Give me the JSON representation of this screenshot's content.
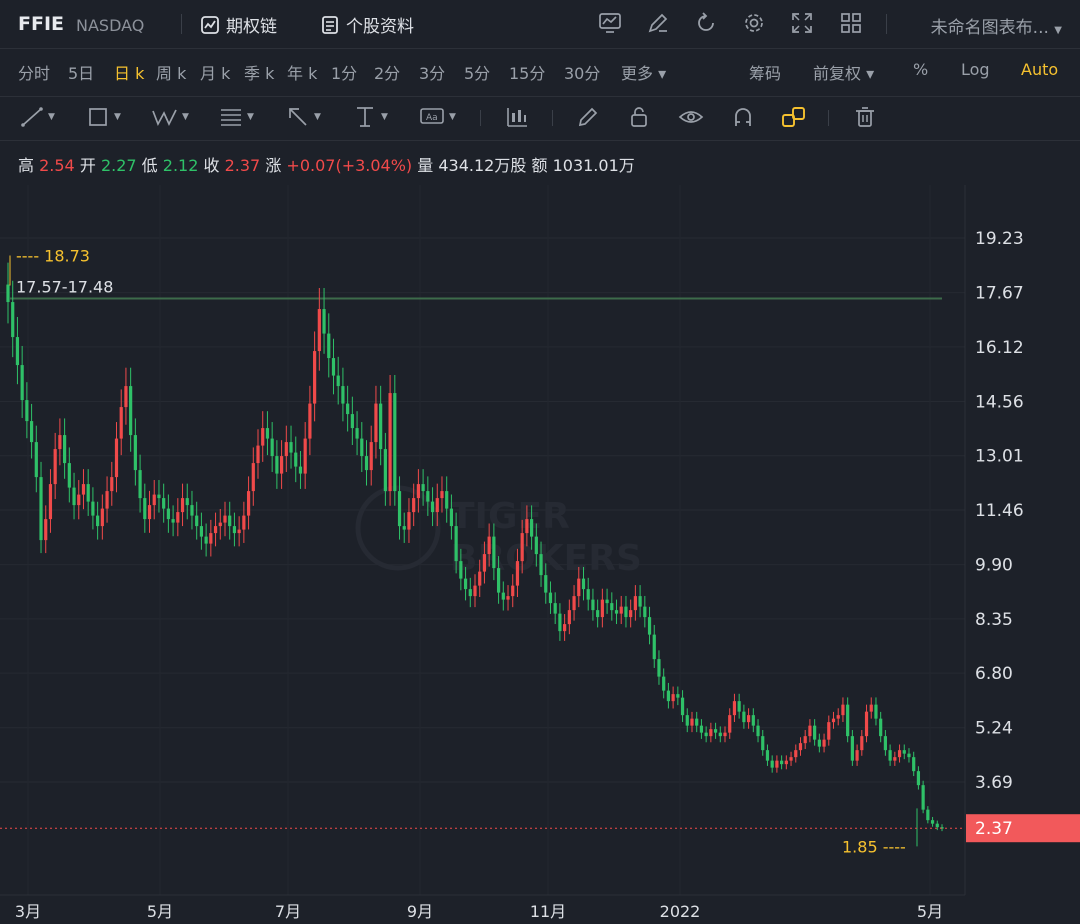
{
  "header": {
    "ticker": "FFIE",
    "exchange": "NASDAQ",
    "options_chain_label": "期权链",
    "profile_label": "个股资料",
    "layout_name": "未命名图表布..."
  },
  "periods": {
    "items": [
      "分时",
      "5日",
      "日 k",
      "周 k",
      "月 k",
      "季 k",
      "年 k",
      "1分",
      "2分",
      "3分",
      "5分",
      "15分",
      "30分",
      "更多"
    ],
    "active": "日 k",
    "right_options": [
      "筹码",
      "前复权",
      "%",
      "Log",
      "Auto"
    ],
    "right_active": "Auto"
  },
  "quote": {
    "high_label": "高",
    "high": "2.54",
    "open_label": "开",
    "open": "2.27",
    "low_label": "低",
    "low": "2.12",
    "close_label": "收",
    "close": "2.37",
    "change_label": "涨",
    "change": "+0.07(+3.04%)",
    "volume_label": "量",
    "volume": "434.12万股",
    "amount_label": "额",
    "amount": "1031.01万"
  },
  "colors": {
    "up": "#f04a4a",
    "down": "#2fc168",
    "accent": "#f5c12f",
    "resistance_line": "#3d6b4a",
    "background": "#1d2129"
  },
  "watermark": [
    "TIGER",
    "BROKERS"
  ],
  "chart_data": {
    "type": "candlestick",
    "y_ticks": [
      "19.23",
      "17.67",
      "16.12",
      "14.56",
      "13.01",
      "11.46",
      "9.90",
      "8.35",
      "6.80",
      "5.24",
      "3.69"
    ],
    "x_ticks": [
      "3月",
      "5月",
      "7月",
      "9月",
      "11月",
      "2022",
      "5月"
    ],
    "ylim": [
      1.3,
      20.3
    ],
    "current_price": "2.37",
    "max_marker": "18.73",
    "min_marker": "1.85",
    "resistance_label": "17.57-17.48",
    "resistance_value": 17.5,
    "closes": [
      17.4,
      16.4,
      15.6,
      14.6,
      14.0,
      13.4,
      12.4,
      10.6,
      11.2,
      12.2,
      13.2,
      13.6,
      12.8,
      12.1,
      11.6,
      11.9,
      12.2,
      11.7,
      11.3,
      11.0,
      11.5,
      12.0,
      12.4,
      13.5,
      14.4,
      15.0,
      13.6,
      12.6,
      11.8,
      11.2,
      11.6,
      11.9,
      11.8,
      11.5,
      11.2,
      11.1,
      11.4,
      11.8,
      11.6,
      11.3,
      11.0,
      10.7,
      10.5,
      10.8,
      11.0,
      11.1,
      11.3,
      11.0,
      10.8,
      10.9,
      11.3,
      12.0,
      12.8,
      13.3,
      13.8,
      13.5,
      13.0,
      12.5,
      13.0,
      13.4,
      13.1,
      12.7,
      12.5,
      13.5,
      14.5,
      16.0,
      17.2,
      16.5,
      15.8,
      15.3,
      15.0,
      14.5,
      14.2,
      13.8,
      13.5,
      13.0,
      12.6,
      13.4,
      14.5,
      13.2,
      12.0,
      14.8,
      12.0,
      11.0,
      10.9,
      11.4,
      11.8,
      12.2,
      12.0,
      11.7,
      11.4,
      11.8,
      12.0,
      11.5,
      11.0,
      10.0,
      9.5,
      9.2,
      9.0,
      9.3,
      9.7,
      10.2,
      10.7,
      9.8,
      9.1,
      8.9,
      9.0,
      9.3,
      10.0,
      10.8,
      11.2,
      10.7,
      10.2,
      9.6,
      9.1,
      8.8,
      8.5,
      8.0,
      8.2,
      8.6,
      9.0,
      9.5,
      9.2,
      8.9,
      8.6,
      8.4,
      8.9,
      8.8,
      8.6,
      8.5,
      8.7,
      8.4,
      8.6,
      9.0,
      8.7,
      8.4,
      7.9,
      7.2,
      6.7,
      6.3,
      6.0,
      6.2,
      6.1,
      5.6,
      5.3,
      5.5,
      5.3,
      5.1,
      5.0,
      5.2,
      5.1,
      5.0,
      5.1,
      5.6,
      6.0,
      5.7,
      5.4,
      5.6,
      5.3,
      5.0,
      4.6,
      4.3,
      4.1,
      4.3,
      4.2,
      4.3,
      4.4,
      4.6,
      4.8,
      5.0,
      5.3,
      4.9,
      4.7,
      4.9,
      5.4,
      5.5,
      5.6,
      5.9,
      5.0,
      4.3,
      4.6,
      5.0,
      5.7,
      5.9,
      5.5,
      5.0,
      4.6,
      4.3,
      4.4,
      4.6,
      4.5,
      4.4,
      4.0,
      3.6,
      2.9,
      2.6,
      2.5,
      2.4,
      2.37
    ]
  }
}
